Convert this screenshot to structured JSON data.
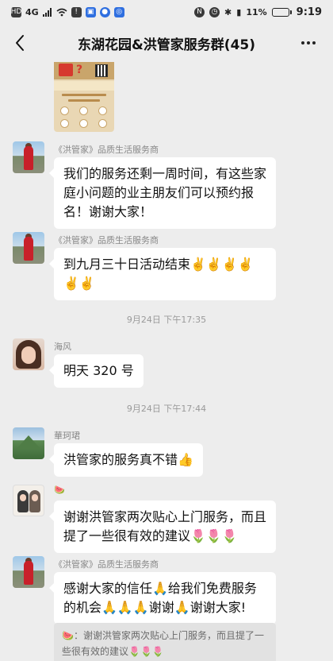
{
  "status_bar": {
    "left_icons": [
      "HD",
      "4G",
      "signal-icon",
      "wifi-icon",
      "app-icon",
      "app-icon",
      "app-icon",
      "app-icon"
    ],
    "network": "HD",
    "network_gen": "4G",
    "battery_percent": "11%",
    "battery_level": 0.11,
    "time": "9:19"
  },
  "header": {
    "title": "东湖花园&洪管家服务群(45)",
    "back_icon": "chevron-left-icon",
    "more_icon": "more-horizontal-icon"
  },
  "messages": [
    {
      "sender": "《洪管家》品质生活服务商",
      "text": "我们的服务还剩一周时间，有这些家庭小问题的业主朋友们可以预约报名！谢谢大家！"
    },
    {
      "sender": "《洪管家》品质生活服务商",
      "text": "到九月三十日活动结束✌️✌️✌️✌️✌️✌️"
    },
    {
      "timestamp": "9月24日 下午17:35"
    },
    {
      "sender": "海风",
      "text": "明天 320 号"
    },
    {
      "timestamp": "9月24日 下午17:44"
    },
    {
      "sender": "華珂珺",
      "text": "洪管家的服务真不错👍"
    },
    {
      "sender": "🍉",
      "text": "谢谢洪管家两次贴心上门服务，而且提了一些很有效的建议🌷🌷🌷"
    },
    {
      "sender": "《洪管家》品质生活服务商",
      "text": "感谢大家的信任🙏给我们免费服务的机会🙏🙏🙏谢谢🙏谢谢大家!"
    }
  ],
  "quote": {
    "text": "🍉：谢谢洪管家两次贴心上门服务，而且提了一些很有效的建议🌷🌷🌷"
  },
  "colors": {
    "background": "#ededed",
    "bubble": "#ffffff",
    "meta_text": "#888888"
  }
}
